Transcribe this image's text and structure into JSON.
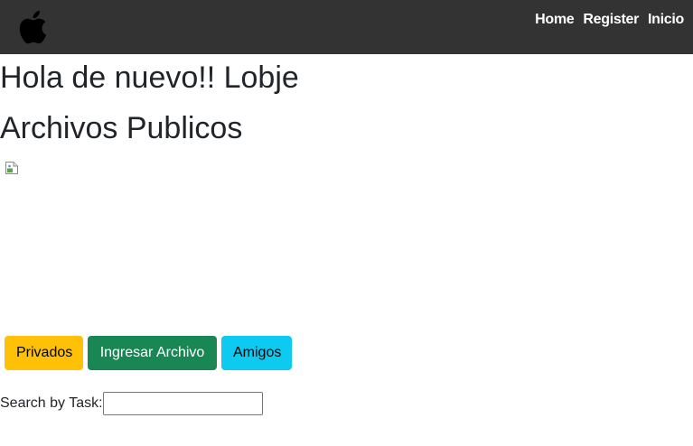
{
  "header": {
    "logo_icon": "apple-icon",
    "background": "#333333",
    "nav": [
      {
        "label": "Home"
      },
      {
        "label": "Register"
      },
      {
        "label": "Inicio"
      }
    ]
  },
  "main": {
    "greeting": "Hola de nuevo!! Lobje",
    "section_title": "Archivos Publicos",
    "image_icon": "broken-image-icon",
    "buttons": {
      "privados": {
        "label": "Privados",
        "color": "#ffc107"
      },
      "ingresar": {
        "label": "Ingresar Archivo",
        "color": "#198754"
      },
      "amigos": {
        "label": "Amigos",
        "color": "#0dcaf0"
      }
    },
    "search": {
      "label": "Search by Task:",
      "value": "",
      "placeholder": ""
    }
  }
}
